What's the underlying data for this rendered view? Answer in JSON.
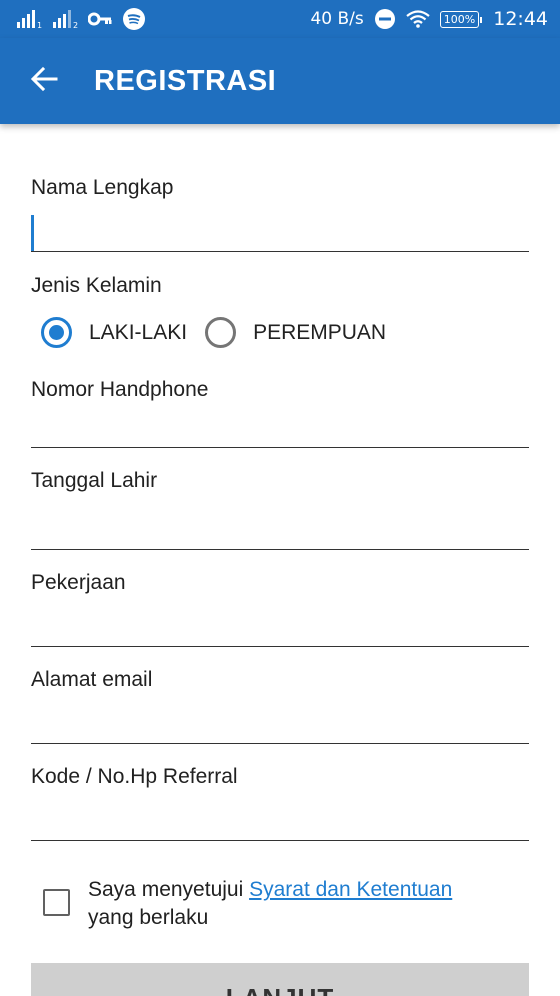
{
  "status_bar": {
    "speed": "40 B/s",
    "battery": "100%",
    "time": "12:44",
    "icons": [
      "signal-1-icon",
      "signal-2-icon",
      "vpn-key-icon",
      "spotify-icon",
      "dnd-icon",
      "wifi-icon",
      "battery-icon"
    ]
  },
  "appbar": {
    "title": "REGISTRASI",
    "back_icon": "arrow-back-icon"
  },
  "form": {
    "full_name": {
      "label": "Nama Lengkap",
      "value": ""
    },
    "gender": {
      "label": "Jenis Kelamin",
      "options": [
        {
          "label": "LAKI-LAKI",
          "selected": true
        },
        {
          "label": "PEREMPUAN",
          "selected": false
        }
      ]
    },
    "phone": {
      "label": "Nomor Handphone",
      "value": ""
    },
    "birth_date": {
      "label": "Tanggal Lahir",
      "value": ""
    },
    "occupation": {
      "label": "Pekerjaan",
      "value": ""
    },
    "email": {
      "label": "Alamat email",
      "value": ""
    },
    "referral": {
      "label": "Kode / No.Hp Referral",
      "value": ""
    }
  },
  "agreement": {
    "prefix": "Saya menyetujui ",
    "link": "Syarat dan Ketentuan",
    "suffix": "yang berlaku",
    "checked": false
  },
  "submit_label": "LANJUT",
  "colors": {
    "primary": "#1f6fbf",
    "accent": "#1f7dd0",
    "button_disabled": "#cfcfcf"
  }
}
